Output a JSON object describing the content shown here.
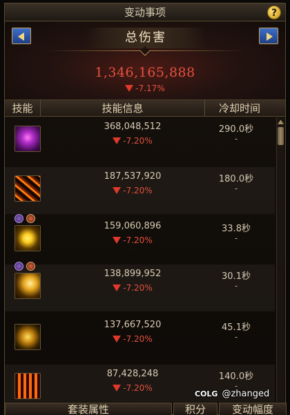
{
  "window": {
    "title": "变动事项"
  },
  "header": {
    "title": "总伤害",
    "total_damage": "1,346,165,888",
    "total_change": "-7.17%"
  },
  "columns": {
    "skill": "技能",
    "info": "技能信息",
    "cooldown": "冷却时间"
  },
  "rows": [
    {
      "icon": "purple-burst-skill-icon",
      "damage": "368,048,512",
      "change": "-7.20%",
      "cooldown": "290.0秒",
      "cd_sub": "-"
    },
    {
      "icon": "fire-claw-skill-icon",
      "damage": "187,537,920",
      "change": "-7.20%",
      "cooldown": "180.0秒",
      "cd_sub": "-"
    },
    {
      "icon": "lightning-skill-icon",
      "damage": "159,060,896",
      "change": "-7.20%",
      "cooldown": "33.8秒",
      "cd_sub": "-"
    },
    {
      "icon": "golden-strike-skill-icon",
      "damage": "138,899,952",
      "change": "-7.20%",
      "cooldown": "30.1秒",
      "cd_sub": "-"
    },
    {
      "icon": "golden-ring-skill-icon",
      "damage": "137,667,520",
      "change": "-7.20%",
      "cooldown": "45.1秒",
      "cd_sub": "-"
    },
    {
      "icon": "flame-eye-skill-icon",
      "damage": "87,428,248",
      "change": "-7.20%",
      "cooldown": "140.0秒",
      "cd_sub": "-"
    }
  ],
  "tabs": {
    "set": "套装属性",
    "points": "积分",
    "change": "变动幅度"
  },
  "watermark": {
    "logo": "COLG",
    "user": "@zhanged"
  },
  "colors": {
    "negative": "#e45141",
    "accent_gold": "#c9a661",
    "nav_blue": "#2e58ad"
  }
}
